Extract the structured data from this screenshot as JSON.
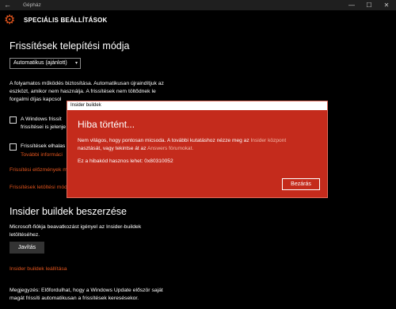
{
  "titlebar": {
    "back_icon": "←",
    "app_title": "Gépház",
    "min_icon": "—",
    "max_icon": "☐",
    "close_icon": "✕"
  },
  "header": {
    "title": "SPECIÁLIS BEÁLLÍTÁSOK"
  },
  "install_mode": {
    "heading": "Frissítések telepítési módja",
    "selected": "Automatikus (ajánlott)",
    "description": [
      "A folyamatos működés biztosítása. Automatikusan újraindítjuk az",
      "eszközt, amikor nem használja. A frissítések nem töltődnek le",
      "forgalmi díjas kapcsol"
    ]
  },
  "options": [
    {
      "lines": [
        "A Windows frissít",
        "frissítései is jelenje"
      ]
    },
    {
      "lines": [
        "Frissítések elhalas"
      ],
      "link": "További informáci"
    }
  ],
  "links": {
    "history": "Frissítési előzmények m",
    "delivery": "Frissítések letöltési mód"
  },
  "insider": {
    "heading": "Insider buildek beszerzése",
    "description": [
      "Microsoft-fiókja beavatkozást igényel az Insider-buildek",
      "letöltéséhez."
    ],
    "fix_button": "Javítás",
    "stop_link": "Insider buildek leállítása"
  },
  "footnote": [
    "Megjegyzés: Előfordulhat, hogy a Windows Update először saját",
    "magát frissíti automatikusan a frissítések keresésekor."
  ],
  "dialog": {
    "window_title": "Insider buildek",
    "heading": "Hiba történt...",
    "msg_part1": "Nem világos, hogy pontosan micsoda. A további kutatáshoz nézze meg az ",
    "msg_link1": "Insider központ",
    "msg_part2": "nasztását, vagy tekintse át az ",
    "msg_link2": "Answers fórumokat.",
    "code_line": "Ez a hibakód hasznos lehet: 0x80310052",
    "close_button": "Bezárás"
  }
}
